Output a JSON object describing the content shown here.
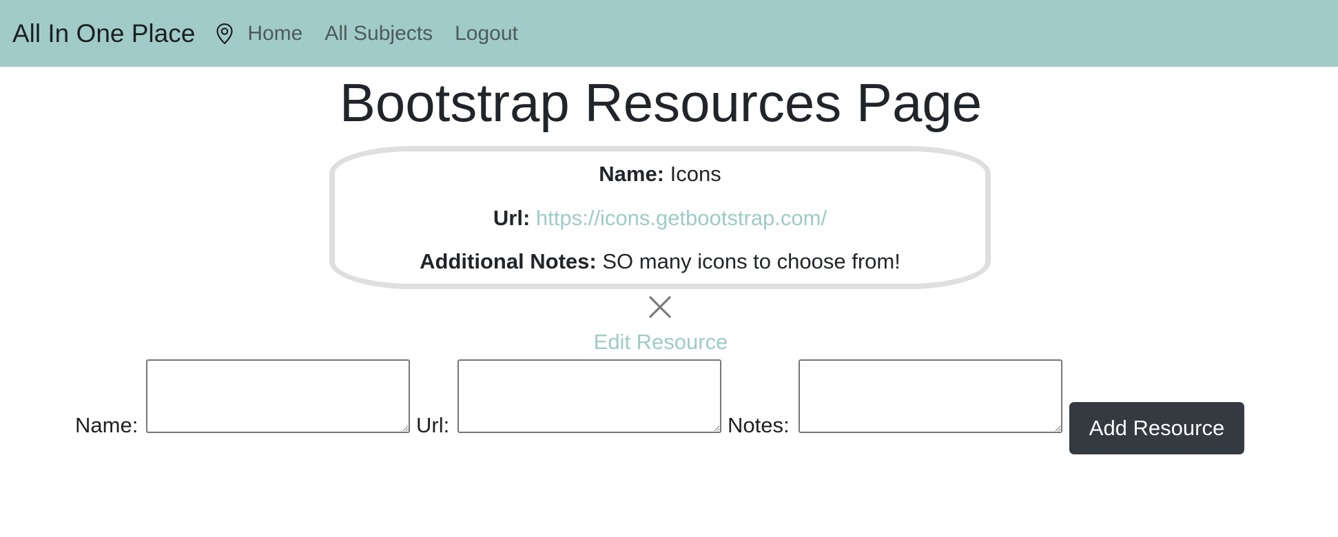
{
  "navbar": {
    "brand": "All In One Place",
    "pin_icon": "map-pin-icon",
    "links": [
      {
        "label": "Home"
      },
      {
        "label": "All Subjects"
      },
      {
        "label": "Logout"
      }
    ],
    "background": "#a0cbc8"
  },
  "page": {
    "title": "Bootstrap Resources Page"
  },
  "resource": {
    "name_label": "Name:",
    "name_value": "Icons",
    "url_label": "Url:",
    "url_value": "https://icons.getbootstrap.com/",
    "notes_label": "Additional Notes:",
    "notes_value": "SO many icons to choose from!",
    "delete_icon": "close-icon",
    "edit_label": "Edit Resource"
  },
  "form": {
    "name_label": "Name:",
    "url_label": "Url:",
    "notes_label": "Notes:",
    "name_value": "",
    "url_value": "",
    "notes_value": "",
    "submit_label": "Add Resource"
  },
  "colors": {
    "accent_link": "#9ecbc6",
    "button_dark": "#343a40",
    "card_border": "#dfdfdf"
  }
}
